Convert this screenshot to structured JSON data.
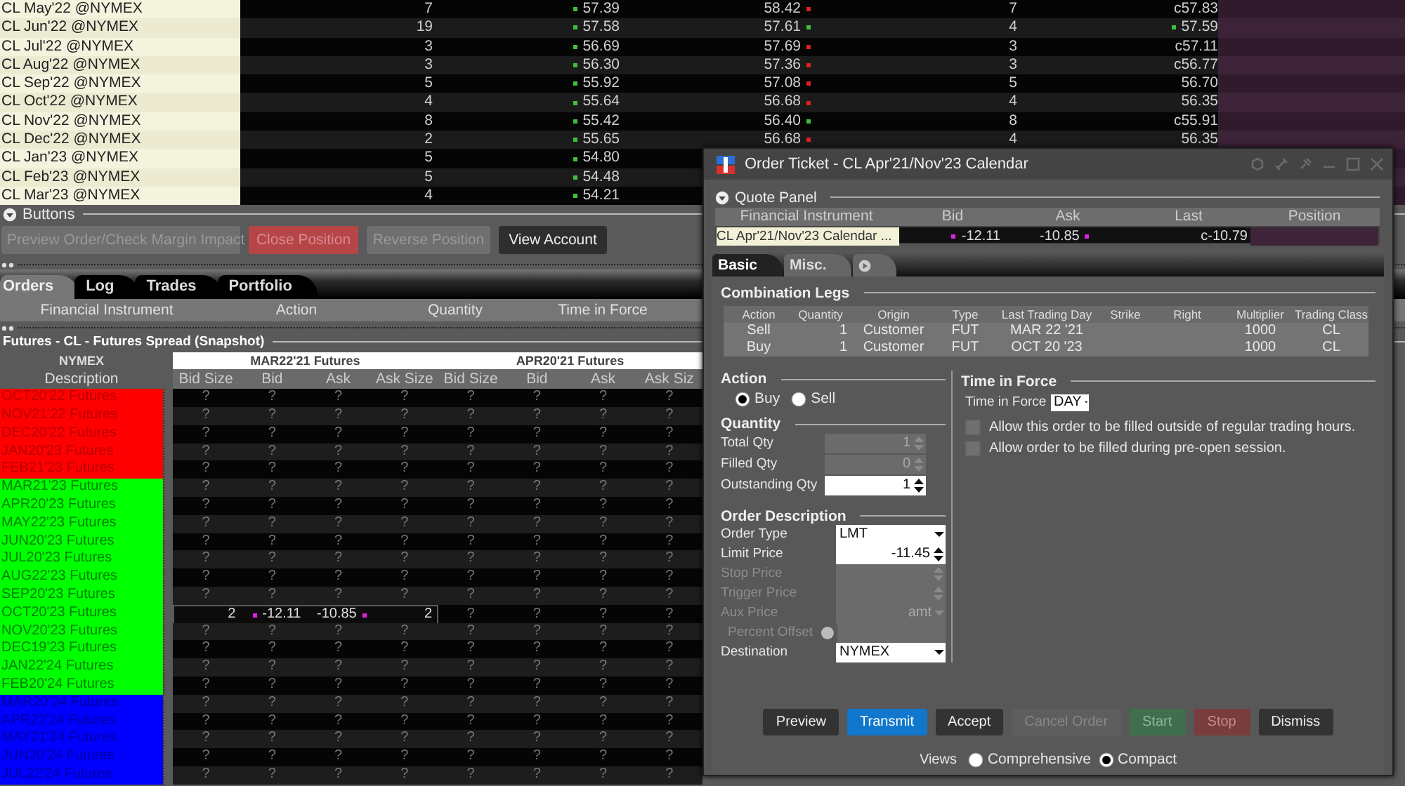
{
  "watchlist": {
    "rows": [
      {
        "instrument": "CL May'22 @NYMEX",
        "bid_size": "7",
        "bid": "57.39",
        "bid_up": true,
        "ask": "58.42",
        "ask_up": false,
        "ask_size": "7",
        "last": "c57.83"
      },
      {
        "instrument": "CL Jun'22 @NYMEX",
        "bid_size": "19",
        "bid": "57.58",
        "bid_up": true,
        "ask": "57.61",
        "ask_up": true,
        "ask_size": "4",
        "last": "57.59",
        "last_up": true
      },
      {
        "instrument": "CL Jul'22 @NYMEX",
        "bid_size": "3",
        "bid": "56.69",
        "bid_up": true,
        "ask": "57.69",
        "ask_up": false,
        "ask_size": "3",
        "last": "c57.11"
      },
      {
        "instrument": "CL Aug'22 @NYMEX",
        "bid_size": "3",
        "bid": "56.30",
        "bid_up": true,
        "ask": "57.36",
        "ask_up": false,
        "ask_size": "3",
        "last": "c56.77"
      },
      {
        "instrument": "CL Sep'22 @NYMEX",
        "bid_size": "5",
        "bid": "55.92",
        "bid_up": true,
        "ask": "57.08",
        "ask_up": false,
        "ask_size": "5",
        "last": "56.70"
      },
      {
        "instrument": "CL Oct'22 @NYMEX",
        "bid_size": "4",
        "bid": "55.64",
        "bid_up": true,
        "ask": "56.68",
        "ask_up": false,
        "ask_size": "4",
        "last": "56.35"
      },
      {
        "instrument": "CL Nov'22 @NYMEX",
        "bid_size": "8",
        "bid": "55.42",
        "bid_up": true,
        "ask": "56.40",
        "ask_up": true,
        "ask_size": "8",
        "last": "c55.91"
      },
      {
        "instrument": "CL Dec'22 @NYMEX",
        "bid_size": "2",
        "bid": "55.65",
        "bid_up": true,
        "ask": "56.68",
        "ask_up": false,
        "ask_size": "4",
        "last": "56.35"
      },
      {
        "instrument": "CL Jan'23 @NYMEX",
        "bid_size": "5",
        "bid": "54.80",
        "bid_up": true
      },
      {
        "instrument": "CL Feb'23 @NYMEX",
        "bid_size": "5",
        "bid": "54.48",
        "bid_up": true
      },
      {
        "instrument": "CL Mar'23 @NYMEX",
        "bid_size": "4",
        "bid": "54.21",
        "bid_up": true
      }
    ]
  },
  "buttons_panel": {
    "title": "Buttons",
    "expanded": true,
    "buttons": [
      {
        "label": "Preview Order/Check Margin Impact",
        "kind": "plain",
        "disabled": true
      },
      {
        "label": "Close Position",
        "kind": "danger",
        "disabled": true
      },
      {
        "label": "Reverse Position",
        "kind": "plain",
        "disabled": true
      },
      {
        "label": "View Account",
        "kind": "plain",
        "disabled": false
      }
    ]
  },
  "orders_panel": {
    "tabs": [
      {
        "label": "Orders",
        "selected": true
      },
      {
        "label": "Log",
        "selected": false
      },
      {
        "label": "Trades",
        "selected": false
      },
      {
        "label": "Portfolio",
        "selected": false
      }
    ],
    "columns": [
      "Financial Instrument",
      "Action",
      "Quantity",
      "Time in Force"
    ]
  },
  "spread_grid": {
    "title": "Futures - CL - Futures Spread (Snapshot)",
    "exchange": "NYMEX",
    "description_header": "Description",
    "groups": [
      "MAR22'21 Futures",
      "APR20'21 Futures"
    ],
    "columns": [
      "Bid Size",
      "Bid",
      "Ask",
      "Ask Size",
      "Bid Size",
      "Bid",
      "Ask",
      "Ask Siz"
    ],
    "rows": [
      {
        "description": "OCT20'22 Futures",
        "color": "#ff0000",
        "selected": false,
        "marked": false,
        "cells": [
          "?",
          "?",
          "?",
          "?",
          "?",
          "?",
          "?",
          "?"
        ]
      },
      {
        "description": "NOV21'22 Futures",
        "color": "#ff0000",
        "selected": false,
        "marked": false,
        "cells": [
          "?",
          "?",
          "?",
          "?",
          "?",
          "?",
          "?",
          "?"
        ]
      },
      {
        "description": "DEC20'22 Futures",
        "color": "#ff0000",
        "selected": false,
        "marked": false,
        "cells": [
          "?",
          "?",
          "?",
          "?",
          "?",
          "?",
          "?",
          "?"
        ]
      },
      {
        "description": "JAN20'23 Futures",
        "color": "#ff0000",
        "selected": false,
        "marked": false,
        "cells": [
          "?",
          "?",
          "?",
          "?",
          "?",
          "?",
          "?",
          "?"
        ]
      },
      {
        "description": "FEB21'23 Futures",
        "color": "#ff0000",
        "selected": false,
        "marked": false,
        "cells": [
          "?",
          "?",
          "?",
          "?",
          "?",
          "?",
          "?",
          "?"
        ]
      },
      {
        "description": "MAR21'23 Futures",
        "color": "#00ff00",
        "selected": false,
        "marked": false,
        "cells": [
          "?",
          "?",
          "?",
          "?",
          "?",
          "?",
          "?",
          "?"
        ]
      },
      {
        "description": "APR20'23 Futures",
        "color": "#00ff00",
        "selected": false,
        "marked": false,
        "cells": [
          "?",
          "?",
          "?",
          "?",
          "?",
          "?",
          "?",
          "?"
        ]
      },
      {
        "description": "MAY22'23 Futures",
        "color": "#00ff00",
        "selected": false,
        "marked": false,
        "cells": [
          "?",
          "?",
          "?",
          "?",
          "?",
          "?",
          "?",
          "?"
        ]
      },
      {
        "description": "JUN20'23 Futures",
        "color": "#00ff00",
        "selected": false,
        "marked": false,
        "cells": [
          "?",
          "?",
          "?",
          "?",
          "?",
          "?",
          "?",
          "?"
        ]
      },
      {
        "description": "JUL20'23 Futures",
        "color": "#00ff00",
        "selected": false,
        "marked": false,
        "cells": [
          "?",
          "?",
          "?",
          "?",
          "?",
          "?",
          "?",
          "?"
        ]
      },
      {
        "description": "AUG22'23 Futures",
        "color": "#00ff00",
        "selected": false,
        "marked": false,
        "cells": [
          "?",
          "?",
          "?",
          "?",
          "?",
          "?",
          "?",
          "?"
        ]
      },
      {
        "description": "SEP20'23 Futures",
        "color": "#00ff00",
        "selected": false,
        "marked": false,
        "cells": [
          "?",
          "?",
          "?",
          "?",
          "?",
          "?",
          "?",
          "?"
        ]
      },
      {
        "description": "OCT20'23 Futures",
        "color": "#00ff00",
        "selected": true,
        "marked": true,
        "cells": [
          "2",
          "-12.11",
          "-10.85",
          "2",
          "?",
          "?",
          "?",
          "?"
        ]
      },
      {
        "description": "NOV20'23 Futures",
        "color": "#00ff00",
        "selected": false,
        "marked": false,
        "cells": [
          "?",
          "?",
          "?",
          "?",
          "?",
          "?",
          "?",
          "?"
        ]
      },
      {
        "description": "DEC19'23 Futures",
        "color": "#00ff00",
        "selected": false,
        "marked": false,
        "cells": [
          "?",
          "?",
          "?",
          "?",
          "?",
          "?",
          "?",
          "?"
        ]
      },
      {
        "description": "JAN22'24 Futures",
        "color": "#00ff00",
        "selected": false,
        "marked": false,
        "cells": [
          "?",
          "?",
          "?",
          "?",
          "?",
          "?",
          "?",
          "?"
        ]
      },
      {
        "description": "FEB20'24 Futures",
        "color": "#00ff00",
        "selected": false,
        "marked": false,
        "cells": [
          "?",
          "?",
          "?",
          "?",
          "?",
          "?",
          "?",
          "?"
        ]
      },
      {
        "description": "MAR20'24 Futures",
        "color": "#0000ff",
        "selected": false,
        "marked": false,
        "cells": [
          "?",
          "?",
          "?",
          "?",
          "?",
          "?",
          "?",
          "?"
        ]
      },
      {
        "description": "APR22'24 Futures",
        "color": "#0000ff",
        "selected": false,
        "marked": false,
        "cells": [
          "?",
          "?",
          "?",
          "?",
          "?",
          "?",
          "?",
          "?"
        ]
      },
      {
        "description": "MAY21'24 Futures",
        "color": "#0000ff",
        "selected": false,
        "marked": false,
        "cells": [
          "?",
          "?",
          "?",
          "?",
          "?",
          "?",
          "?",
          "?"
        ]
      },
      {
        "description": "JUN20'24 Futures",
        "color": "#0000ff",
        "selected": false,
        "marked": false,
        "cells": [
          "?",
          "?",
          "?",
          "?",
          "?",
          "?",
          "?",
          "?"
        ]
      },
      {
        "description": "JUL22'24 Futures",
        "color": "#0000ff",
        "selected": false,
        "marked": false,
        "cells": [
          "?",
          "?",
          "?",
          "?",
          "?",
          "?",
          "?",
          "?"
        ]
      }
    ]
  },
  "order_ticket": {
    "title": "Order Ticket - CL Apr'21/Nov'23 Calendar",
    "quote_panel": {
      "title": "Quote Panel",
      "expanded": true,
      "columns": [
        "Financial Instrument",
        "Bid",
        "Ask",
        "Last",
        "Position"
      ],
      "row": {
        "instrument": "CL Apr'21/Nov'23 Calendar ...",
        "bid": "-12.11",
        "ask": "-10.85",
        "last": "c-10.79"
      }
    },
    "tabs": [
      {
        "kind": "text",
        "label": "Basic",
        "selected": true
      },
      {
        "kind": "text",
        "label": "Misc.",
        "selected": false
      },
      {
        "kind": "icon",
        "selected": false
      }
    ],
    "legs": {
      "title": "Combination Legs",
      "columns": [
        "Action",
        "Quantity",
        "Origin",
        "Type",
        "Last Trading Day",
        "Strike",
        "Right",
        "Multiplier",
        "Trading Class"
      ],
      "rows": [
        {
          "action": "Sell",
          "quantity": "1",
          "origin": "Customer",
          "type": "FUT",
          "last_trading_day": "MAR 22 '21",
          "multiplier": "1000",
          "trading_class": "CL"
        },
        {
          "action": "Buy",
          "quantity": "1",
          "origin": "Customer",
          "type": "FUT",
          "last_trading_day": "OCT 20 '23",
          "multiplier": "1000",
          "trading_class": "CL"
        }
      ]
    },
    "action": {
      "title": "Action",
      "options": [
        {
          "label": "Buy",
          "selected": true
        },
        {
          "label": "Sell",
          "selected": false
        }
      ]
    },
    "quantity": {
      "title": "Quantity",
      "fields": [
        {
          "label": "Total Qty",
          "value": "1",
          "disabled": true
        },
        {
          "label": "Filled Qty",
          "value": "0",
          "disabled": true
        },
        {
          "label": "Outstanding Qty",
          "value": "1",
          "disabled": false
        }
      ]
    },
    "order_description": {
      "title": "Order Description",
      "fields": [
        {
          "label": "Order Type",
          "kind": "select",
          "value": "LMT",
          "disabled": false
        },
        {
          "label": "Limit Price",
          "kind": "spin",
          "value": "-11.45",
          "disabled": false
        },
        {
          "label": "Stop Price",
          "kind": "spin",
          "disabled": true
        },
        {
          "label": "Trigger Price",
          "kind": "spin",
          "disabled": true
        },
        {
          "label": "Aux Price",
          "kind": "select",
          "value": "amt",
          "disabled": true
        },
        {
          "label": "Percent Offset",
          "kind": "radio_text",
          "disabled": true,
          "option_selected": false
        },
        {
          "label": "Destination",
          "kind": "select",
          "value": "NYMEX",
          "disabled": false
        }
      ]
    },
    "time_in_force": {
      "title": "Time in Force",
      "label": "Time in Force",
      "value": "DAY",
      "options": [
        {
          "label": "Allow this order to be filled outside of regular trading hours.",
          "checked": false
        },
        {
          "label": "Allow order to be filled during pre-open session.",
          "checked": false
        }
      ]
    },
    "buttons": [
      {
        "label": "Preview",
        "kind": "plain",
        "disabled": false
      },
      {
        "label": "Transmit",
        "kind": "primary",
        "disabled": false
      },
      {
        "label": "Accept",
        "kind": "plain",
        "disabled": false
      },
      {
        "label": "Cancel Order",
        "kind": "plain",
        "disabled": true
      },
      {
        "label": "Start",
        "kind": "go",
        "disabled": true
      },
      {
        "label": "Stop",
        "kind": "danger",
        "disabled": true
      },
      {
        "label": "Dismiss",
        "kind": "plain",
        "disabled": false
      }
    ],
    "views": {
      "label": "Views",
      "options": [
        {
          "label": "Comprehensive",
          "selected": false
        },
        {
          "label": "Compact",
          "selected": true
        }
      ]
    }
  }
}
